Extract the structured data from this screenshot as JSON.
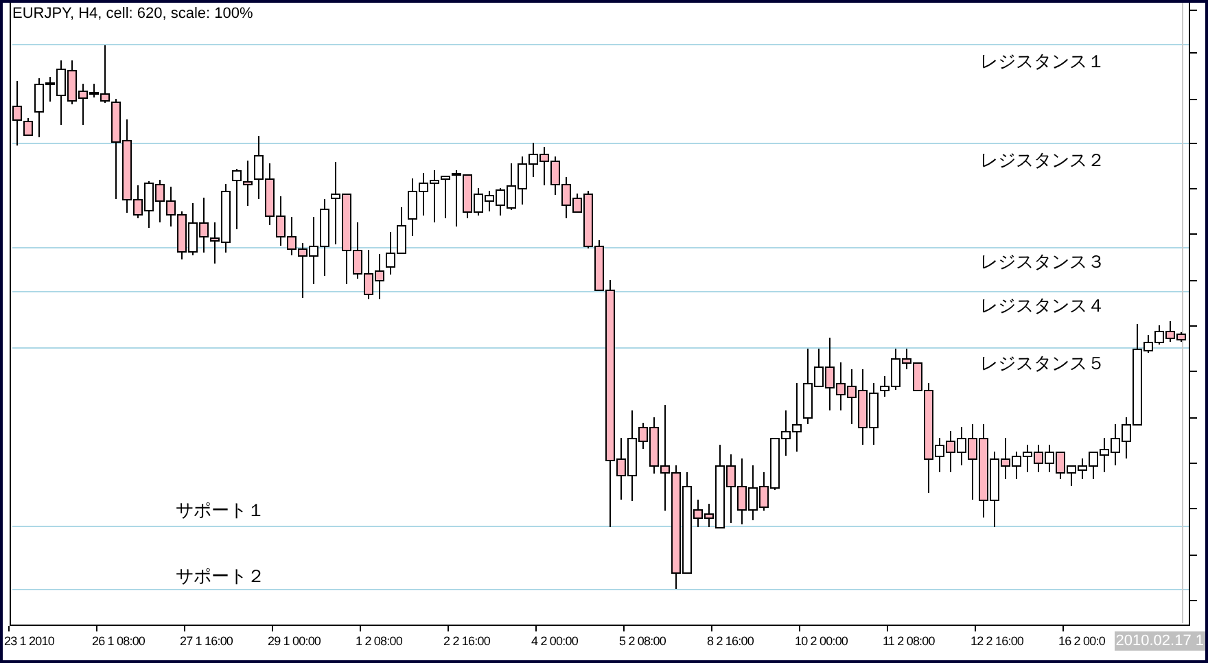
{
  "chart": {
    "title": "EURJPY, H4, cell: 620, scale: 100%",
    "levels": [
      {
        "label": "レジスタンス１"
      },
      {
        "label": "レジスタンス２"
      },
      {
        "label": "レジスタンス３"
      },
      {
        "label": "レジスタンス４"
      },
      {
        "label": "レジスタンス５"
      },
      {
        "label": "サポート１"
      },
      {
        "label": "サポート２"
      }
    ],
    "time_labels": [
      "23 1 2010",
      "26 1 08:00",
      "27 1 16:00",
      "29 1 00:00",
      "1 2 08:00",
      "2 2 16:00",
      "4 2 00:00",
      "5 2 08:00",
      "8 2 16:00",
      "10 2 00:00",
      "11 2 08:00",
      "12 2 16:00",
      "16 2 00:0"
    ],
    "cursor_time": "2010.02.17 1"
  }
}
